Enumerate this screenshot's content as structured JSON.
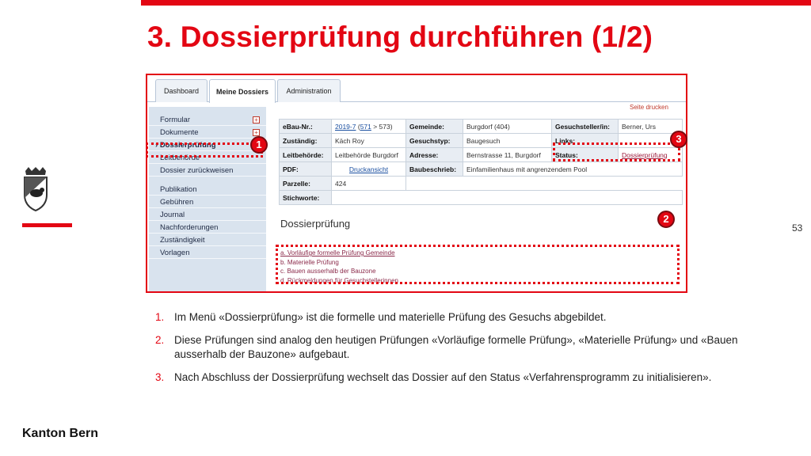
{
  "slide": {
    "title": "3. Dossierprüfung durchführen (1/2)",
    "page_number": "53",
    "brand": "Kanton Bern"
  },
  "tabs": [
    {
      "label": "Dashboard"
    },
    {
      "label": "Meine Dossiers"
    },
    {
      "label": "Administration"
    }
  ],
  "menu": [
    {
      "label": "Formular",
      "has_plus": true
    },
    {
      "label": "Dokumente",
      "has_plus": true
    },
    {
      "label": "Dossierprüfung",
      "active": true
    },
    {
      "label": "Leitbehörde"
    },
    {
      "label": "Dossier zurückweisen"
    },
    {
      "label": "Publikation"
    },
    {
      "label": "Gebühren"
    },
    {
      "label": "Journal"
    },
    {
      "label": "Nachforderungen"
    },
    {
      "label": "Zuständigkeit"
    },
    {
      "label": "Vorlagen"
    }
  ],
  "menu_active_marker": "›",
  "plus_symbol": "+",
  "print_link": "Seite drucken",
  "info": {
    "ebau_label": "eBau-Nr.:",
    "ebau_main": "2019-7",
    "ebau_paren_open": "(",
    "ebau_sub": "571",
    "ebau_rest": " > 573)",
    "gemeinde_label": "Gemeinde:",
    "gemeinde_value": "Burgdorf (404)",
    "gesuchsteller_label": "Gesuchsteller/in:",
    "gesuchsteller_value": "Berner, Urs",
    "zustaendig_label": "Zuständig:",
    "zustaendig_value": "Käch Roy",
    "gesuchstyp_label": "Gesuchstyp:",
    "gesuchstyp_value": "Baugesuch",
    "links_label": "Links:",
    "links_value": "",
    "leitbehoerde_label": "Leitbehörde:",
    "leitbehoerde_value": "Leitbehörde Burgdorf",
    "adresse_label": "Adresse:",
    "adresse_value": "Bernstrasse 11, Burgdorf",
    "status_label": "Status:",
    "status_value": "Dossierprüfung",
    "pdf_label": "PDF:",
    "pdf_value": "Druckansicht",
    "baubeschrieb_label": "Baubeschrieb:",
    "baubeschrieb_value": "Einfamilienhaus mit angrenzendem Pool",
    "parzelle_label": "Parzelle:",
    "parzelle_value": "424",
    "stichworte_label": "Stichworte:",
    "stichworte_value": ""
  },
  "section": {
    "title": "Dossierprüfung",
    "items": [
      "a. Vorläufige formelle Prüfung Gemeinde",
      "b. Materielle Prüfung",
      "c. Bauen ausserhalb der Bauzone",
      "d. Rückmeldungen für Gesuchstellerinnen"
    ]
  },
  "badges": [
    "1",
    "2",
    "3"
  ],
  "notes": [
    {
      "num": "1.",
      "text": "Im Menü «Dossierprüfung» ist die formelle und materielle Prüfung des Gesuchs abgebildet."
    },
    {
      "num": "2.",
      "text": "Diese Prüfungen sind analog den heutigen Prüfungen «Vorläufige formelle Prüfung», «Materielle Prüfung» und «Bauen ausserhalb der Bauzone» aufgebaut."
    },
    {
      "num": "3.",
      "text": "Nach Abschluss der Dossierprüfung wechselt das Dossier auf den Status «Verfahrensprogramm zu initialisieren»."
    }
  ],
  "colors": {
    "accent": "#e30613",
    "menu_bg": "#d9e3ee",
    "label_bg": "#e8edf3"
  }
}
